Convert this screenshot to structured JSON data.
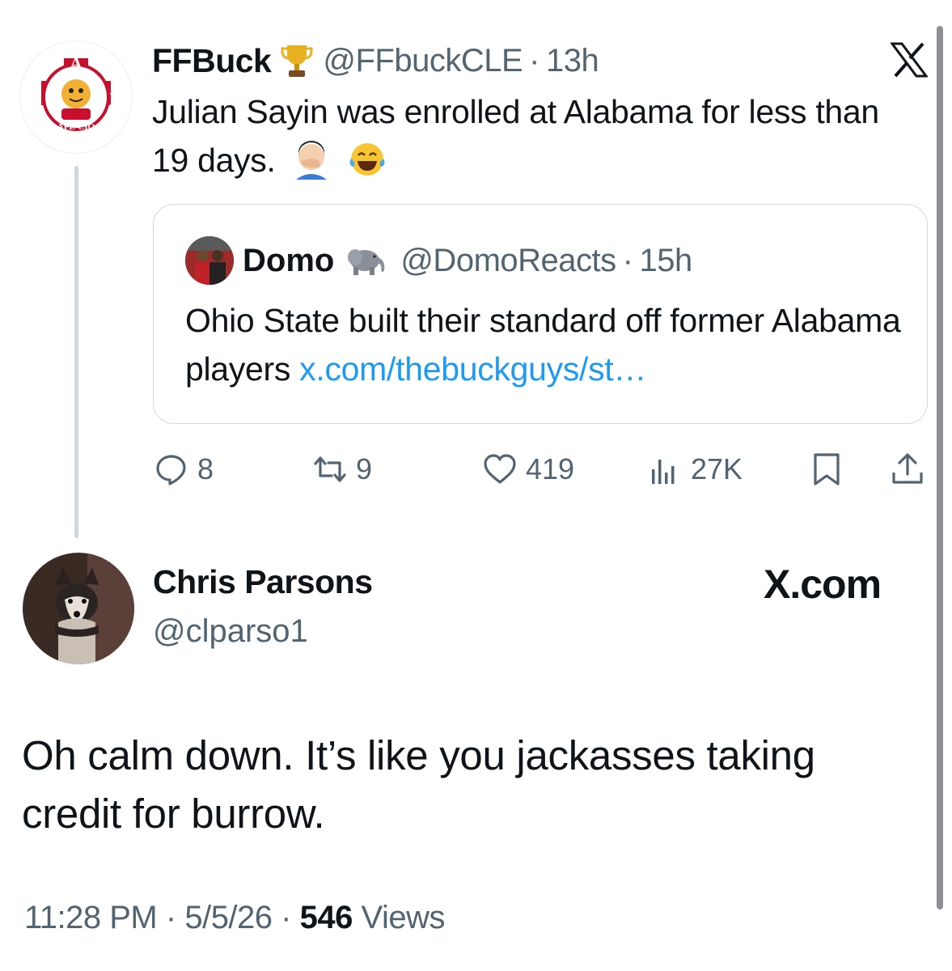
{
  "parent_tweet": {
    "display_name": "FFBuck",
    "handle": "@FFbuckCLE",
    "separator": "·",
    "time": "13h",
    "text": "Julian Sayin was enrolled at Alabama for less than 19 days.",
    "avatar_text": {
      "top": "A",
      "left": "I",
      "right": "F",
      "ring": "INTERNATIONAL",
      "bottom1": "AFL-CIO",
      "bottom2": "CLC"
    },
    "icons": [
      "trophy-emoji",
      "facepalm-emoji",
      "tears-of-joy-emoji",
      "x-logo-icon"
    ]
  },
  "quoted_tweet": {
    "display_name": "Domo",
    "handle": "@DomoReacts",
    "separator": "·",
    "time": "15h",
    "text": "Ohio State built their standard off former Alabama players",
    "link": "x.com/thebuckguys/st…",
    "icons": [
      "elephant-emoji"
    ]
  },
  "actions": {
    "replies": "8",
    "reposts": "9",
    "likes": "419",
    "views": "27K",
    "icons": [
      "reply-icon",
      "repost-icon",
      "like-icon",
      "views-icon",
      "bookmark-icon",
      "share-icon"
    ]
  },
  "reply_tweet": {
    "display_name": "Chris Parsons",
    "handle": "@clparso1",
    "brand": "X.com",
    "text": "Oh calm down. It’s like you jackasses taking credit for burrow.",
    "time": "11:28 PM",
    "date": "5/5/26",
    "separator": "·",
    "views_count": "546",
    "views_label": "Views"
  },
  "colors": {
    "text": "#0f1419",
    "secondary": "#536471",
    "link": "#1d9bf0",
    "border": "#cfd9de"
  }
}
